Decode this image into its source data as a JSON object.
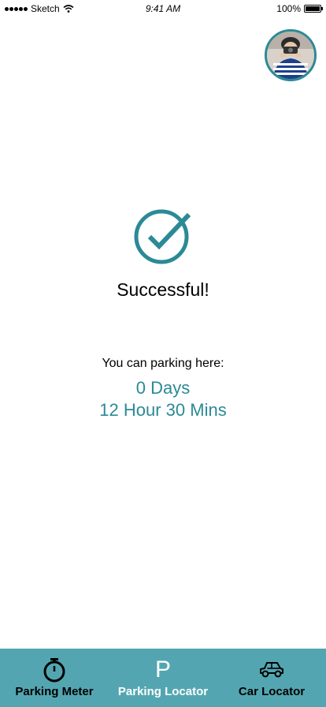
{
  "status_bar": {
    "carrier": "Sketch",
    "time": "9:41 AM",
    "battery": "100%"
  },
  "profile": {
    "avatar_icon": "user-avatar-icon"
  },
  "result": {
    "title": "Successful!",
    "parking_label": "You can parking here:",
    "days": "0 Days",
    "time": "12 Hour 30 Mins",
    "icon": "check-circle-icon"
  },
  "tabs": [
    {
      "label": "Parking Meter",
      "icon": "stopwatch-icon"
    },
    {
      "label": "Parking Locator",
      "icon": "parking-p-icon",
      "glyph": "P"
    },
    {
      "label": "Car Locator",
      "icon": "car-icon"
    }
  ],
  "colors": {
    "accent": "#2b8a96",
    "tab_bar": "#53a6b1"
  }
}
